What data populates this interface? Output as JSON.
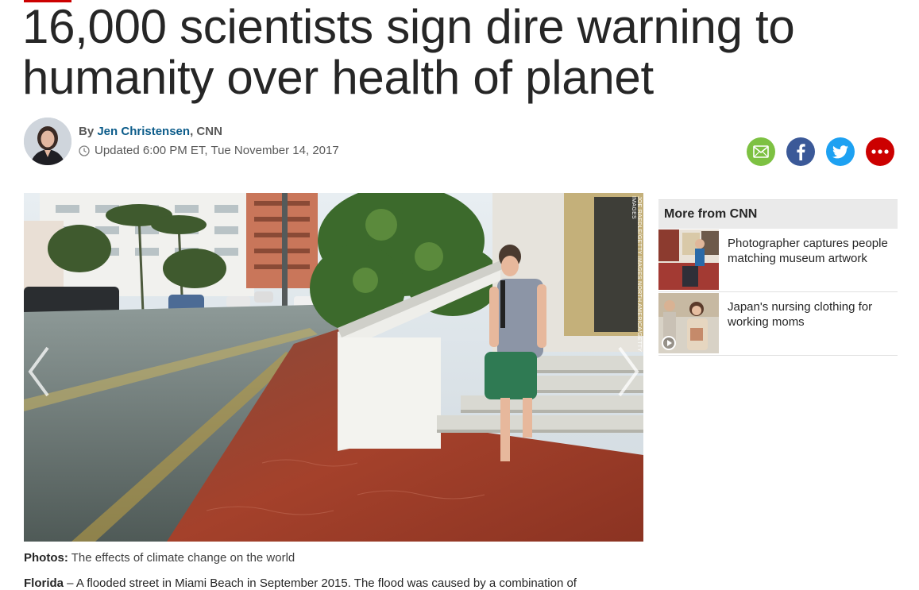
{
  "article": {
    "headline": "16,000 scientists sign dire warning to humanity over health of planet",
    "byline_prefix": "By ",
    "author": "Jen Christensen",
    "outlet": ", CNN",
    "updated": "Updated 6:00 PM ET, Tue November 14, 2017",
    "photo_credit": "JOE RAEDLE/GETTY IMAGES NORTH AMERICA/GETTY IMAGES",
    "caption_label": "Photos:",
    "caption_text": " The effects of climate change on the world",
    "body_start_label": "Florida",
    "body_start_text": " – A flooded street in Miami Beach in September 2015. The flood was caused by a combination of"
  },
  "share": {
    "icons": [
      "email-icon",
      "facebook-icon",
      "twitter-icon",
      "more-icon"
    ],
    "colors": {
      "email": "#7dc142",
      "facebook": "#3b5998",
      "twitter": "#1da1f2",
      "more": "#cc0000"
    }
  },
  "rail": {
    "header": "More from CNN",
    "items": [
      {
        "text": "Photographer captures people matching museum artwork"
      },
      {
        "text": "Japan's nursing clothing for working moms",
        "has_video": true
      }
    ]
  },
  "theme": {
    "brand": "#cc0000",
    "link": "#0c5c8a"
  }
}
